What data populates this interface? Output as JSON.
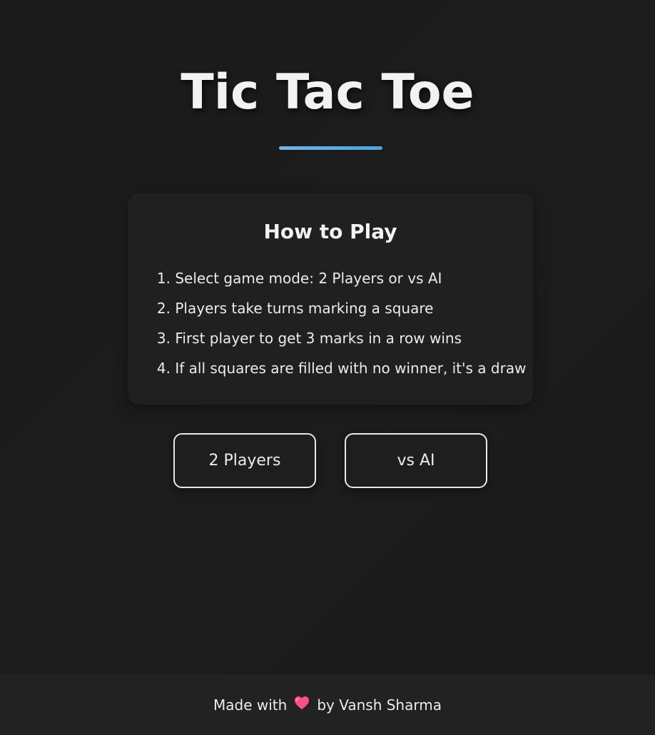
{
  "header": {
    "title": "Tic Tac Toe"
  },
  "how_to_play": {
    "title": "How to Play",
    "steps": [
      {
        "num": "1.",
        "text": " Select game mode: 2 Players or vs AI"
      },
      {
        "num": "2.",
        "text": " Players take turns marking a square"
      },
      {
        "num": "3.",
        "text": " First player to get 3 marks in a row wins"
      },
      {
        "num": "4.",
        "text": " If all squares are filled with no winner, it's a draw"
      }
    ]
  },
  "modes": {
    "two_players_label": "2 Players",
    "vs_ai_label": "vs AI"
  },
  "footer": {
    "made_with": "Made with",
    "heart_icon": "heart-icon",
    "author": "by Vansh Sharma"
  },
  "colors": {
    "background": "#1a1a1a",
    "card": "#202020",
    "accent": "#4aa3e0",
    "heart": "#ff3e7f",
    "footer": "#222222"
  }
}
